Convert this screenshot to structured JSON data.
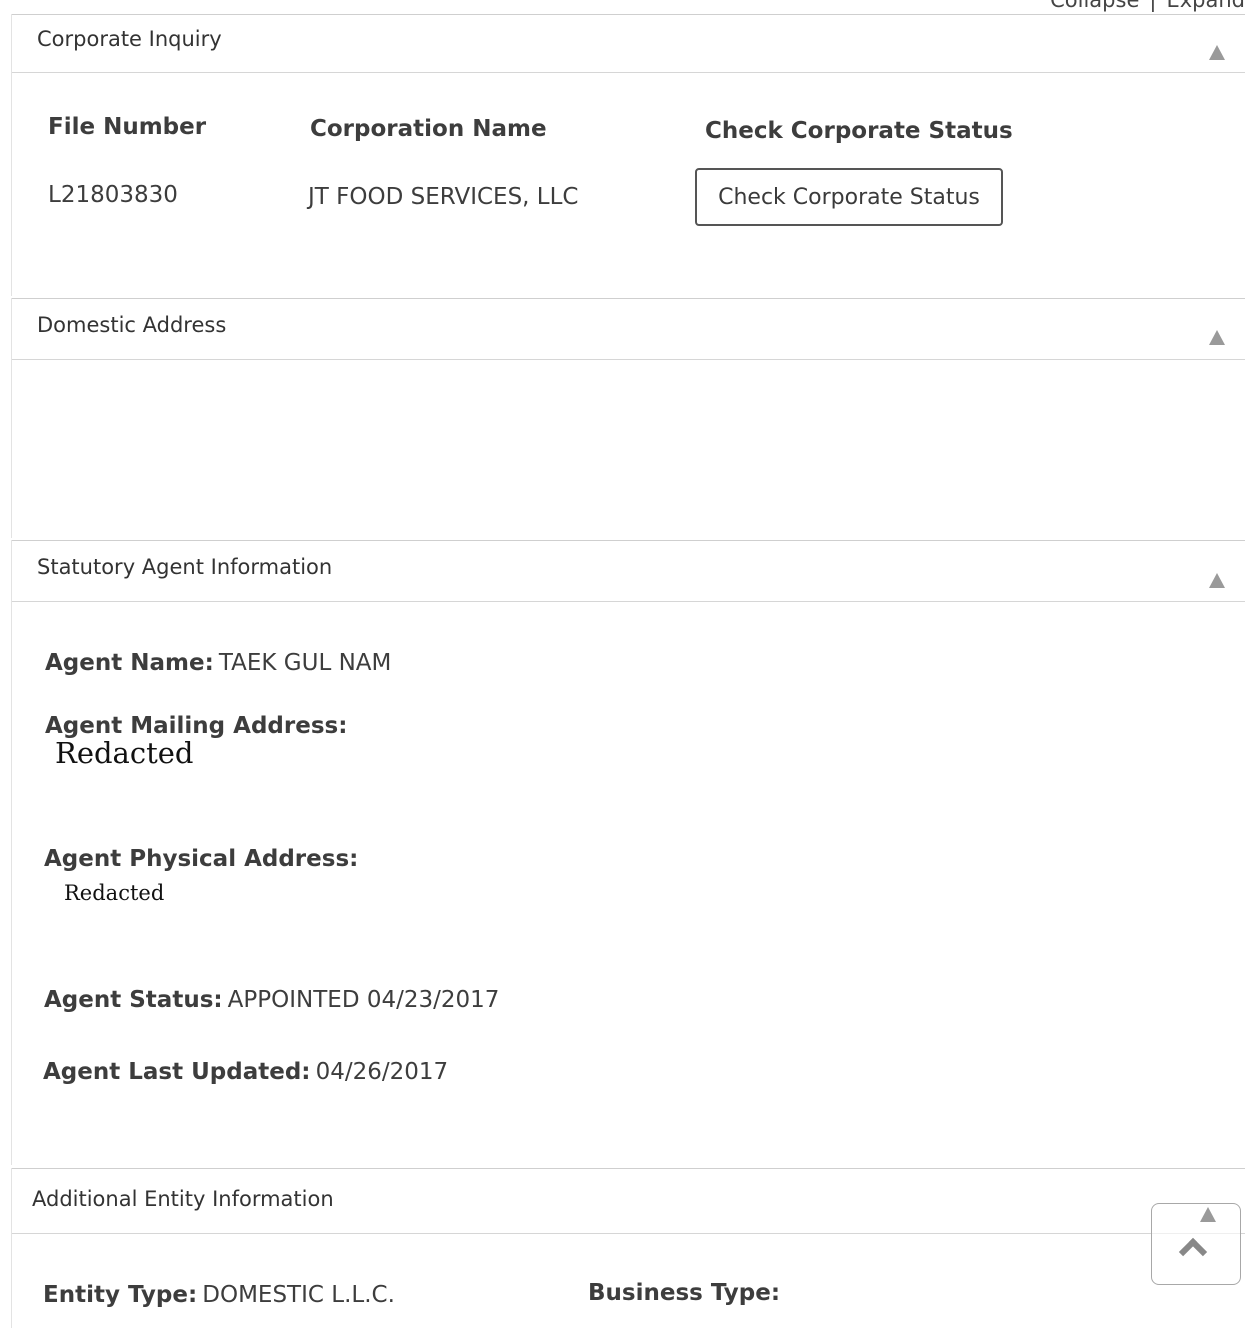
{
  "top_links": {
    "collapse": "Collapse",
    "separator": "|",
    "expand": "Expand"
  },
  "corporate_inquiry": {
    "title": "Corporate Inquiry",
    "file_number_label": "File Number",
    "file_number_value": "L21803830",
    "corp_name_label": "Corporation Name",
    "corp_name_value": "JT FOOD SERVICES, LLC",
    "check_status_label": "Check Corporate Status",
    "check_status_button": "Check Corporate Status"
  },
  "domestic_address": {
    "title": "Domestic Address"
  },
  "statutory_agent": {
    "title": "Statutory Agent Information",
    "agent_name_label": "Agent Name:",
    "agent_name_value": "TAEK GUL NAM",
    "mailing_label": "Agent Mailing Address:",
    "mailing_value": "Redacted",
    "physical_label": "Agent Physical Address:",
    "physical_value": "Redacted",
    "status_label": "Agent Status:",
    "status_value": "APPOINTED 04/23/2017",
    "updated_label": "Agent Last Updated:",
    "updated_value": "04/26/2017"
  },
  "additional_entity": {
    "title": "Additional Entity Information",
    "entity_type_label": "Entity Type:",
    "entity_type_value": "DOMESTIC L.L.C.",
    "business_type_label": "Business Type:",
    "business_type_value": ""
  }
}
